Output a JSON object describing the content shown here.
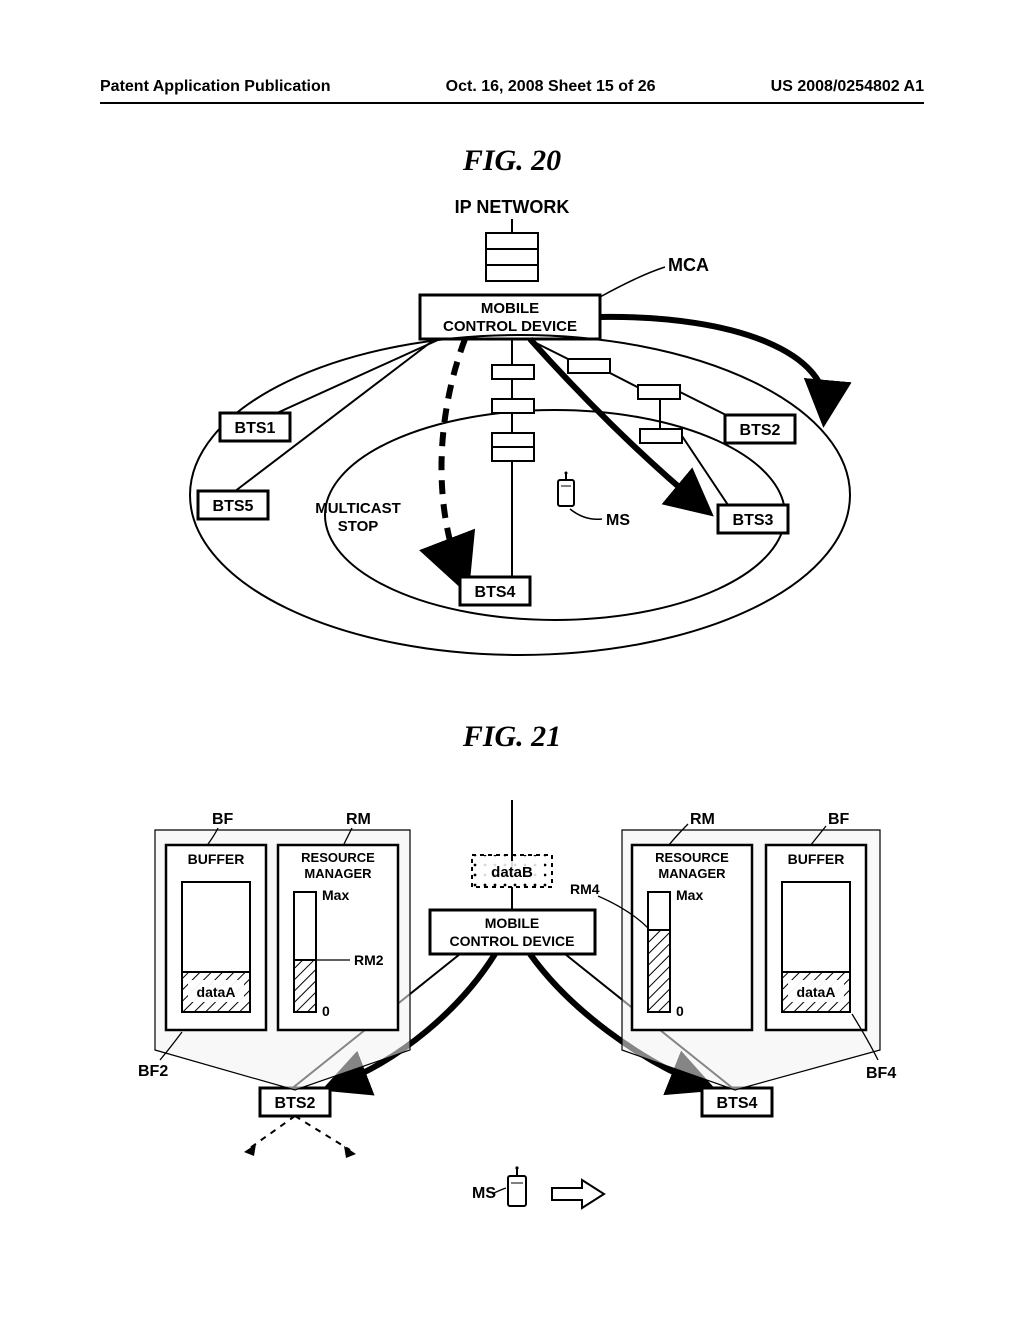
{
  "header": {
    "left": "Patent Application Publication",
    "center": "Oct. 16, 2008  Sheet 15 of 26",
    "right": "US 2008/0254802 A1"
  },
  "fig20": {
    "title": "FIG. 20",
    "ip_network": "IP NETWORK",
    "mca_label": "MCA",
    "mobile_control": "MOBILE\nCONTROL DEVICE",
    "bts1": "BTS1",
    "bts2": "BTS2",
    "bts3": "BTS3",
    "bts4": "BTS4",
    "bts5": "BTS5",
    "ms": "MS",
    "multicast_stop": "MULTICAST\nSTOP"
  },
  "fig21": {
    "title": "FIG. 21",
    "bf_label": "BF",
    "rm_label": "RM",
    "buffer": "BUFFER",
    "resource_manager": "RESOURCE\nMANAGER",
    "max": "Max",
    "zero": "0",
    "rm2": "RM2",
    "rm4": "RM4",
    "dataA": "dataA",
    "dataB": "dataB",
    "bf2": "BF2",
    "bf4": "BF4",
    "mobile_control": "MOBILE\nCONTROL DEVICE",
    "bts2": "BTS2",
    "bts4": "BTS4",
    "ms": "MS"
  }
}
